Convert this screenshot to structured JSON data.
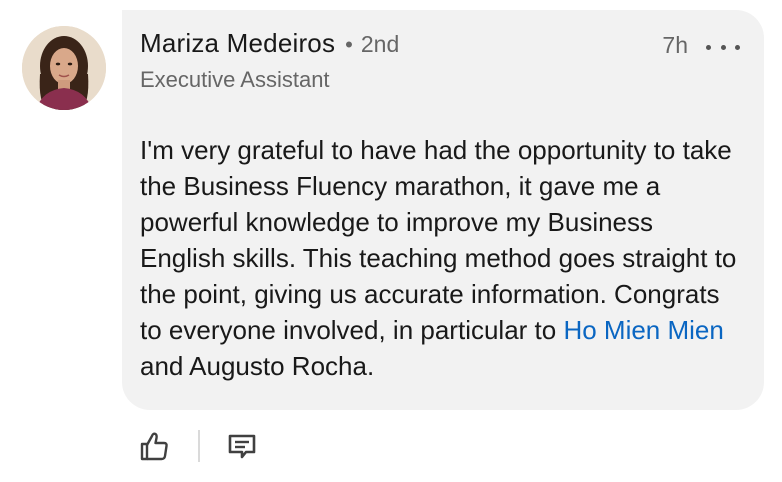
{
  "comment": {
    "author": {
      "name": "Mariza Medeiros",
      "separator": "•",
      "degree": "2nd",
      "headline": "Executive Assistant",
      "avatar_icon": "profile-photo"
    },
    "time": "7h",
    "more_icon": "ellipsis-icon",
    "body": {
      "text_before": "I'm very grateful to have had the opportunity to take the Business Fluency marathon, it gave me a powerful knowledge to improve my Business English skills. This teaching method goes straight to the point, giving us accurate information. Congrats to everyone involved, in particular to ",
      "mention": "Ho Mien Mien",
      "text_after": " and Augusto Rocha."
    },
    "actions": {
      "like_icon": "thumbs-up-icon",
      "reply_icon": "comment-icon"
    }
  },
  "colors": {
    "bubble_bg": "#f2f2f2",
    "text": "#191919",
    "secondary_text": "#666666",
    "mention": "#0a66c2"
  }
}
